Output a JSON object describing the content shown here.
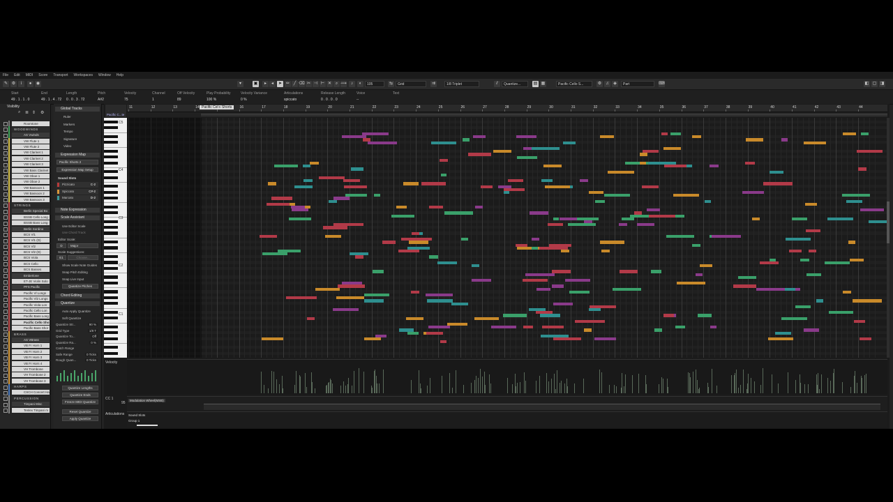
{
  "menu": [
    "File",
    "Edit",
    "MIDI",
    "Score",
    "Transport",
    "Workspaces",
    "Window",
    "Help"
  ],
  "toolbar": {
    "quantize_preset": "105",
    "grid_type": "Grid",
    "quantize_value": "1/8 Triplet",
    "quantize_label": "Quantize...",
    "track_selector": "Pacific Cello S...",
    "part_label": "Part"
  },
  "infoline": {
    "columns": [
      {
        "label": "Start",
        "value": "49 . 1 . 1 . 0"
      },
      {
        "label": "End",
        "value": "49 . 1 . 4 . 72"
      },
      {
        "label": "Length",
        "value": "0 . 0 . 3 . 72"
      },
      {
        "label": "Pitch",
        "value": "A#2"
      },
      {
        "label": "Velocity",
        "value": "75"
      },
      {
        "label": "Channel",
        "value": "1"
      },
      {
        "label": "Off Velocity",
        "value": "89"
      },
      {
        "label": "Play Probability",
        "value": "100 %"
      },
      {
        "label": "Velocity Variance",
        "value": "0 %"
      },
      {
        "label": "Articulations",
        "value": "spiccato"
      },
      {
        "label": "Release Length",
        "value": "0 . 0 . 0 . 0"
      },
      {
        "label": "Voice",
        "value": "--"
      },
      {
        "label": "Text",
        "value": ""
      }
    ]
  },
  "visibility": {
    "title": "Visibility",
    "tracks": [
      {
        "name": "Roomtone",
        "type": "track",
        "color": "#7a7a7a"
      },
      {
        "name": "WOODWINDS",
        "type": "folder",
        "color": "#3fa35a"
      },
      {
        "name": "AS Vwinds",
        "type": "sub",
        "color": "#3fa35a"
      },
      {
        "name": "VW Flute 1",
        "type": "track",
        "color": "#d8c24a"
      },
      {
        "name": "VW Flute 2",
        "type": "track",
        "color": "#d8c24a"
      },
      {
        "name": "VW Clarinet 1",
        "type": "track",
        "color": "#d8c24a"
      },
      {
        "name": "VW Clarinet 2",
        "type": "track",
        "color": "#d8c24a"
      },
      {
        "name": "VW Clarinet 3",
        "type": "track",
        "color": "#d8c24a"
      },
      {
        "name": "VW Bass Clarinet",
        "type": "track",
        "color": "#d8c24a"
      },
      {
        "name": "VW Oboe 1",
        "type": "track",
        "color": "#d8c24a"
      },
      {
        "name": "VW Oboe 2",
        "type": "track",
        "color": "#d8c24a"
      },
      {
        "name": "VW Bassoon 1",
        "type": "track",
        "color": "#d8c24a"
      },
      {
        "name": "VW Bassoon 2",
        "type": "track",
        "color": "#d8c24a"
      },
      {
        "name": "VW Bassoon 3",
        "type": "track",
        "color": "#d8c24a"
      },
      {
        "name": "STRINGS",
        "type": "folder",
        "color": "#c04a4a"
      },
      {
        "name": "Berlin Special Bo",
        "type": "sub",
        "color": "#c04a4a"
      },
      {
        "name": "BSSB Cello Long",
        "type": "track",
        "color": "#c04a4a"
      },
      {
        "name": "BSSB Bass Long",
        "type": "track",
        "color": "#c04a4a"
      },
      {
        "name": "Berlin Sordino",
        "type": "sub",
        "color": "#c04a4a"
      },
      {
        "name": "BCS Vl1",
        "type": "track",
        "color": "#c04a4a"
      },
      {
        "name": "BCS Vl1 (D)",
        "type": "track",
        "color": "#c04a4a"
      },
      {
        "name": "BCS Vl2",
        "type": "track",
        "color": "#c04a4a"
      },
      {
        "name": "BCS Vl2 (D)",
        "type": "track",
        "color": "#c04a4a"
      },
      {
        "name": "BCS Viola",
        "type": "track",
        "color": "#c04a4a"
      },
      {
        "name": "BCS Cello",
        "type": "track",
        "color": "#c04a4a"
      },
      {
        "name": "BCS Basses",
        "type": "track",
        "color": "#c04a4a"
      },
      {
        "name": "Emberlone",
        "type": "sub",
        "color": "#c04a4a"
      },
      {
        "name": "ET-JE Violin Solo",
        "type": "track",
        "color": "#c04a4a"
      },
      {
        "name": "PFS Pacific",
        "type": "sub",
        "color": "#c04a4a"
      },
      {
        "name": "Pacific Vl Longs",
        "type": "track",
        "color": "#c04a4a"
      },
      {
        "name": "Pacific Vl2 Longs",
        "type": "track",
        "color": "#c04a4a"
      },
      {
        "name": "Pacific Viola Lon",
        "type": "track",
        "color": "#c04a4a"
      },
      {
        "name": "Pacific Cello Lon",
        "type": "track",
        "color": "#c04a4a"
      },
      {
        "name": "Pacific Bass Long",
        "type": "track",
        "color": "#c04a4a"
      },
      {
        "name": "Pacific Cello Sho",
        "type": "track",
        "color": "#c04a4a",
        "selected": true
      },
      {
        "name": "Pacific Bass Shor",
        "type": "track",
        "color": "#c04a4a"
      },
      {
        "name": "BRASS",
        "type": "folder",
        "color": "#d89a3a"
      },
      {
        "name": "AS VBrass",
        "type": "sub",
        "color": "#d89a3a"
      },
      {
        "name": "VB Fr Horn 1",
        "type": "track",
        "color": "#d89a3a"
      },
      {
        "name": "VB Fr Horn 2",
        "type": "track",
        "color": "#d89a3a"
      },
      {
        "name": "VB Fr Horn 3",
        "type": "track",
        "color": "#d89a3a"
      },
      {
        "name": "VB Fr Horn 4",
        "type": "track",
        "color": "#d89a3a"
      },
      {
        "name": "VH Trombone",
        "type": "track",
        "color": "#d89a3a"
      },
      {
        "name": "VH Trombone 2",
        "type": "track",
        "color": "#d89a3a"
      },
      {
        "name": "VH Trombone 3",
        "type": "track",
        "color": "#d89a3a"
      },
      {
        "name": "HARPS",
        "type": "folder",
        "color": "#4a7ac0"
      },
      {
        "name": "CSCH Concert Har",
        "type": "track",
        "color": "#4a7ac0"
      },
      {
        "name": "PERCUSSION",
        "type": "folder",
        "color": "#8a8a8a"
      },
      {
        "name": "Timpani Misc",
        "type": "sub",
        "color": "#8a8a8a"
      },
      {
        "name": "Tenlex Timpani m",
        "type": "track",
        "color": "#8a8a8a"
      }
    ]
  },
  "inspector": {
    "global_tracks": "Global Tracks",
    "global_items": [
      "Ruler",
      "Markers",
      "Tempo",
      "Signature",
      "Video"
    ],
    "expression_map": "Expression Map",
    "expression_map_value": "Pacific Shorts 2",
    "expression_map_setup": "Expression Map Setup",
    "sound_slots": "Sound Slots",
    "slots": [
      {
        "name": "Pizzicato",
        "key": "C-2",
        "color": "#b83a3a"
      },
      {
        "name": "Spiccato",
        "key": "C#-2",
        "color": "#d8963a"
      },
      {
        "name": "Marcato",
        "key": "D-2",
        "color": "#3a9a9a"
      }
    ],
    "note_expression": "Note Expression",
    "scale_assistant": "Scale Assistant",
    "use_editor_scale": "Use Editor Scale",
    "use_chord_track": "Use Chord Track",
    "editor_scale": "Editor Scale:",
    "scale_root": "D",
    "scale_mode": "Major",
    "scale_suggestions": "Scale Suggestions:",
    "suggestion_value": "E1",
    "suggestion_choose": "Choose...",
    "show_scale_guides": "Show Scale Note Guides",
    "snap_pitch_editing": "Snap Pitch Editing",
    "snap_live_input": "Snap Live Input",
    "quantize_pitches": "Quantize Pitches",
    "chord_editing": "Chord Editing",
    "quantize": "Quantize",
    "auto_apply": "Auto Apply Quantize",
    "soft_quantize": "Soft Quantize",
    "q_rows": [
      {
        "label": "Quantize Str...",
        "value": "90 %"
      },
      {
        "label": "Grid Type",
        "value": "1/8 T"
      },
      {
        "label": "Quantize To...",
        "value": "Off"
      },
      {
        "label": "Quantize Ra...",
        "value": "0 %"
      },
      {
        "label": "Catch Range",
        "value": ""
      },
      {
        "label": "Safe Range",
        "value": "0 Ticks"
      },
      {
        "label": "Rough Quan...",
        "value": "0 Ticks"
      }
    ],
    "buttons": [
      "Quantize Lengths",
      "Quantize Ends",
      "Freeze MIDI Quantize",
      "Reset Quantize",
      "Apply Quantize"
    ]
  },
  "editor": {
    "part_name": "Pacific Cello Shorts",
    "part_short": "Pacific C...te",
    "bars": [
      "11",
      "12",
      "13",
      "14",
      "15",
      "16",
      "17",
      "18",
      "19",
      "20",
      "21",
      "22",
      "23",
      "24",
      "25",
      "26",
      "27",
      "28",
      "29",
      "30",
      "31",
      "32",
      "33",
      "34",
      "35",
      "36",
      "37",
      "38",
      "39",
      "40",
      "41",
      "42",
      "43",
      "44"
    ],
    "key_labels": [
      "C5",
      "C4",
      "C3",
      "C2",
      "C1"
    ],
    "velocity_label": "Velocity",
    "cc_label": "CC 1",
    "cc_value": "95",
    "cc_name": "Modulation Wheel(MSB)",
    "articulations_label": "Articulations",
    "art_rows": [
      "Sound Slots",
      "Group 1"
    ]
  }
}
